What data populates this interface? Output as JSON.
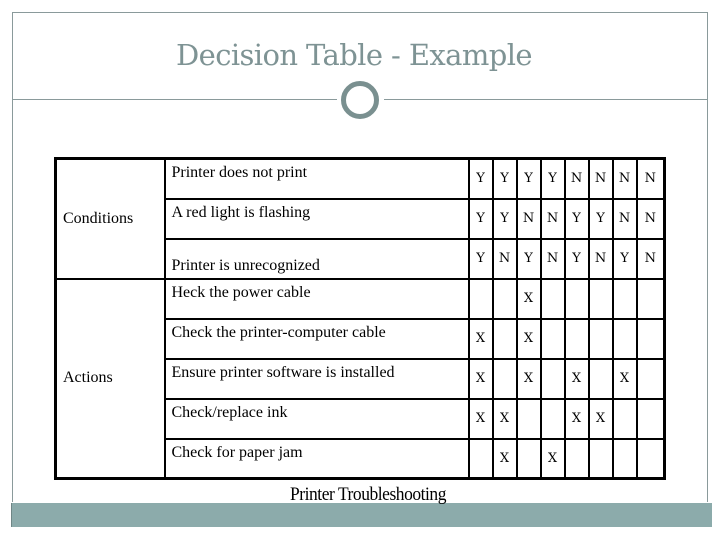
{
  "slide": {
    "title": "Decision Table - Example",
    "caption": "Printer Troubleshooting",
    "colors": {
      "accent": "#7e9394",
      "footer_band": "#8cabab",
      "frame": "#8a9a9b"
    }
  },
  "decision_table": {
    "groups": {
      "conditions": "Conditions",
      "actions": "Actions"
    },
    "conditions": [
      {
        "label": "Printer does not print",
        "values": [
          "Y",
          "Y",
          "Y",
          "Y",
          "N",
          "N",
          "N",
          "N"
        ]
      },
      {
        "label": "A red light is flashing",
        "values": [
          "Y",
          "Y",
          "N",
          "N",
          "Y",
          "Y",
          "N",
          "N"
        ]
      },
      {
        "label": "Printer is unrecognized",
        "values": [
          "Y",
          "N",
          "Y",
          "N",
          "Y",
          "N",
          "Y",
          "N"
        ]
      }
    ],
    "actions": [
      {
        "label": "Heck the power cable",
        "values": [
          "",
          "",
          "X",
          "",
          "",
          "",
          "",
          ""
        ]
      },
      {
        "label": "Check the printer-computer cable",
        "values": [
          "X",
          "",
          "X",
          "",
          "",
          "",
          "",
          ""
        ]
      },
      {
        "label": "Ensure printer software is installed",
        "values": [
          "X",
          "",
          "X",
          "",
          "X",
          "",
          "X",
          ""
        ]
      },
      {
        "label": "Check/replace ink",
        "values": [
          "X",
          "X",
          "",
          "",
          "X",
          "X",
          "",
          ""
        ]
      },
      {
        "label": "Check for paper jam",
        "values": [
          "",
          "X",
          "",
          "X",
          "",
          "",
          "",
          ""
        ]
      }
    ]
  }
}
